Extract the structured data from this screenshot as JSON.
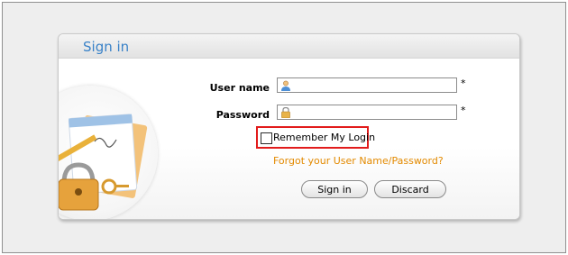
{
  "title": "Sign in",
  "form": {
    "username_label": "User name",
    "password_label": "Password",
    "required_mark": "*",
    "username_value": "",
    "password_value": "",
    "remember_label": "Remember My Login",
    "remember_checked": false,
    "forgot_link": "Forgot your User Name/Password?",
    "signin_button": "Sign in",
    "discard_button": "Discard"
  },
  "icons": {
    "username_icon": "user-icon",
    "password_icon": "lock-icon",
    "illustration": "notepad-lock-illustration"
  },
  "colors": {
    "title": "#3a82c8",
    "link": "#e38a00",
    "highlight_border": "#e21c1c"
  }
}
